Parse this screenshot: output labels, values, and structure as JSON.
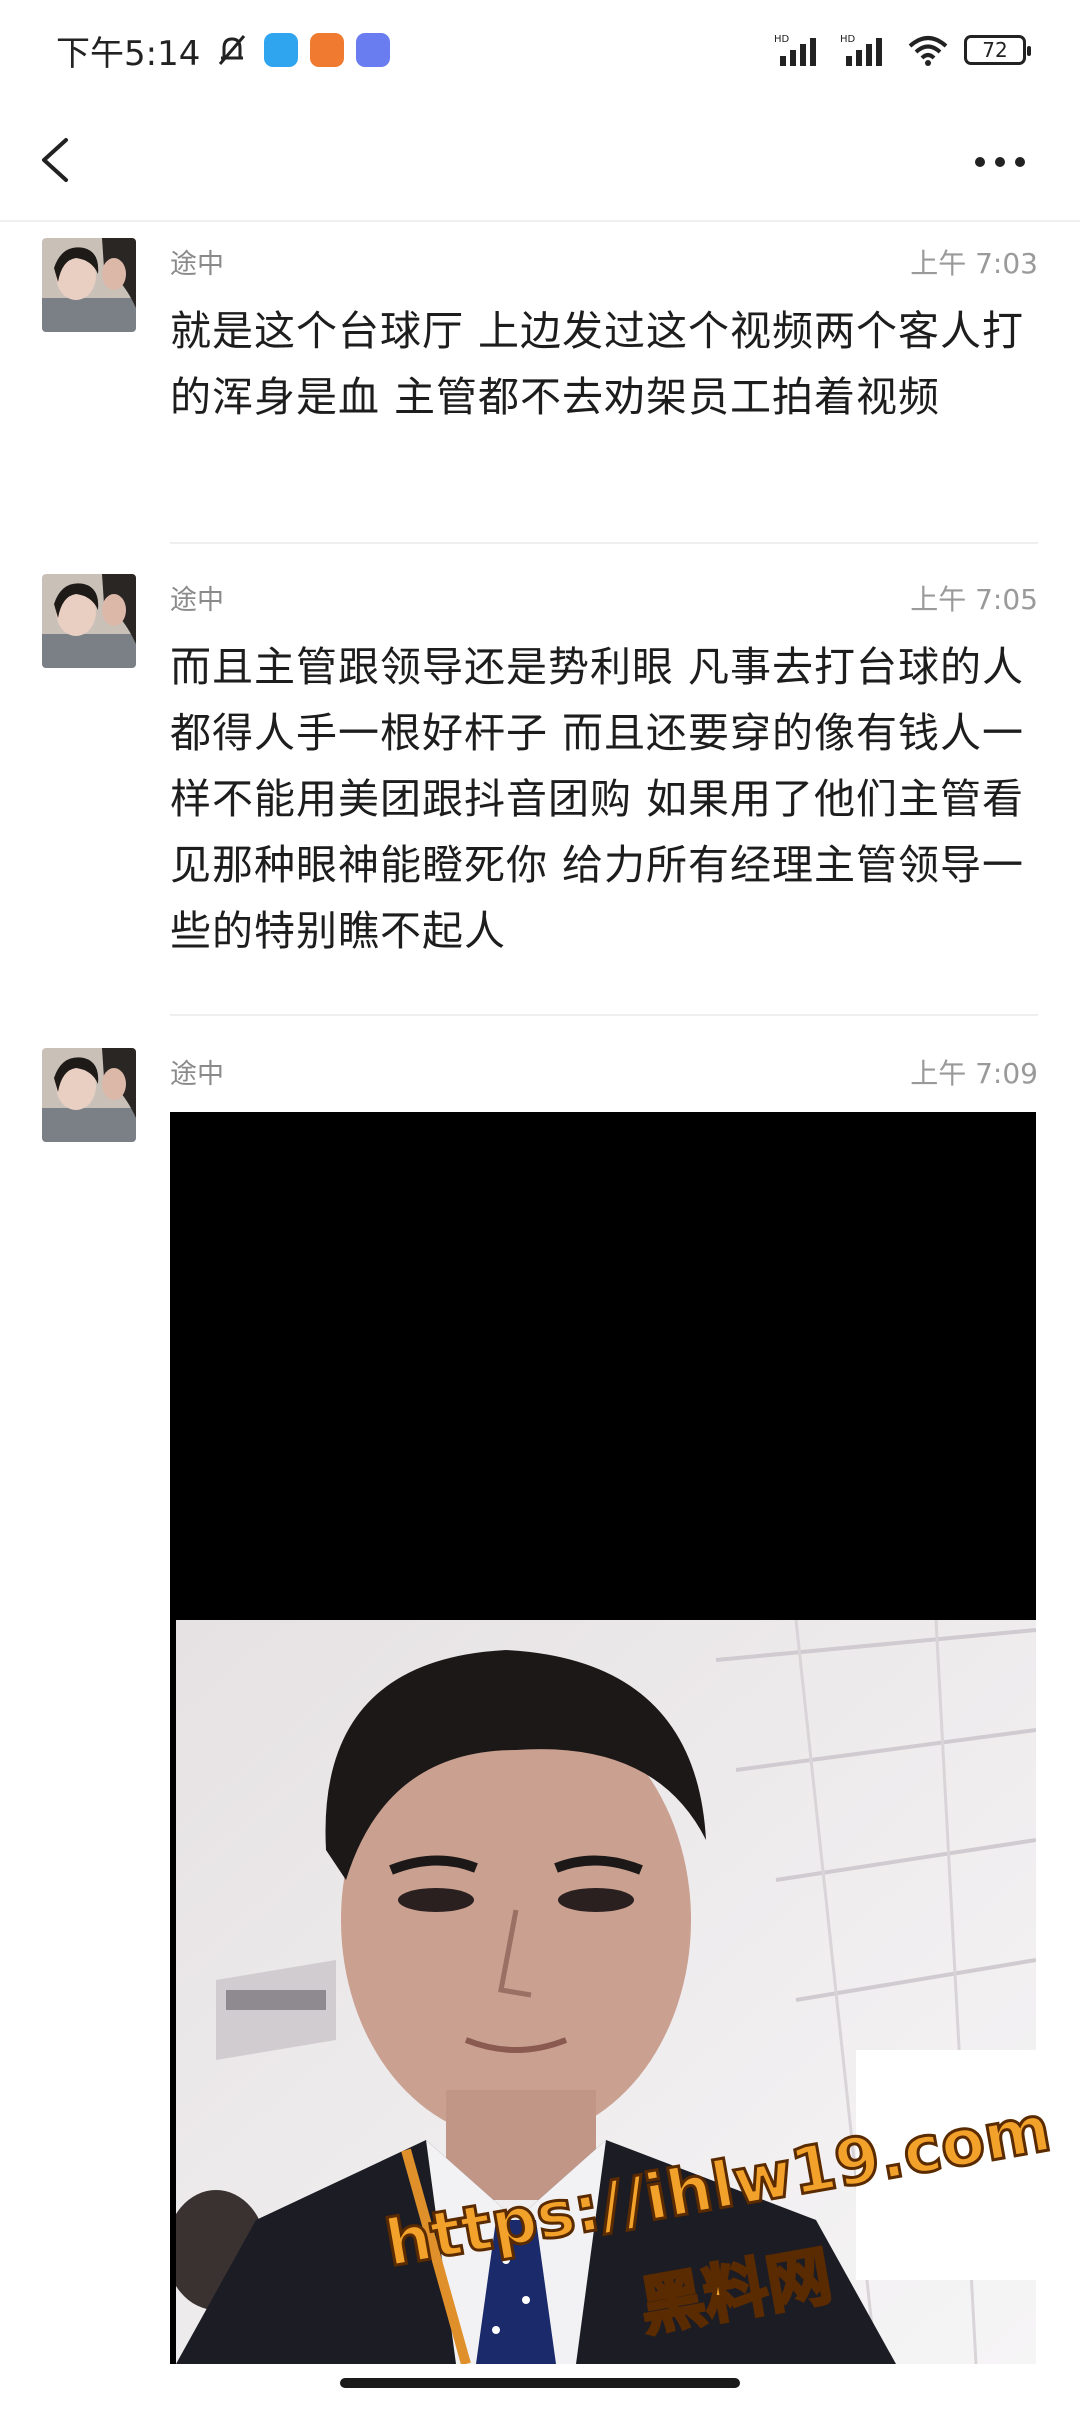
{
  "status_bar": {
    "time": "下午5:14",
    "battery": "72",
    "signal_label_1": "HD",
    "signal_label_2": "HD"
  },
  "nav": {
    "back_icon": "chevron-left-icon",
    "more_icon": "more-horizontal-icon"
  },
  "messages": [
    {
      "sender": "途中",
      "time": "上午 7:03",
      "text": "就是这个台球厅 上边发过这个视频两个客人打的浑身是血 主管都不去劝架员工拍着视频"
    },
    {
      "sender": "途中",
      "time": "上午 7:05",
      "text": "而且主管跟领导还是势利眼 凡事去打台球的人都得人手一根好杆子 而且还要穿的像有钱人一样不能用美团跟抖音团购 如果用了他们主管看见那种眼神能瞪死你 给力所有经理主管领导一些的特别瞧不起人"
    },
    {
      "sender": "途中",
      "time": "上午 7:09"
    }
  ],
  "watermark": {
    "url": "https://ihlw19.com",
    "label": "黑料网"
  }
}
